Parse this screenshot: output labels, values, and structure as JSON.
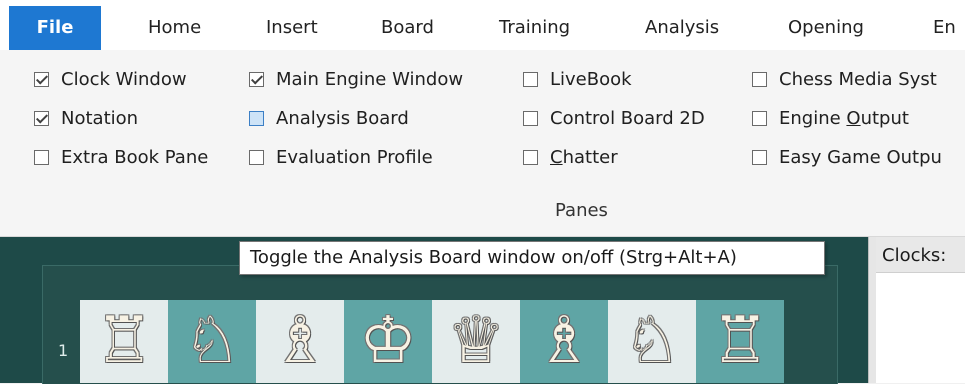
{
  "menu": {
    "tabs": [
      {
        "label": "File",
        "active": true
      },
      {
        "label": "Home"
      },
      {
        "label": "Insert"
      },
      {
        "label": "Board"
      },
      {
        "label": "Training"
      },
      {
        "label": "Analysis"
      },
      {
        "label": "Opening"
      },
      {
        "label": "En"
      }
    ]
  },
  "ribbon": {
    "group_label": "Panes",
    "col1": [
      {
        "label": "Clock Window",
        "checked": true
      },
      {
        "label": "Notation",
        "checked": true
      },
      {
        "label": "Extra Book Pane",
        "checked": false
      }
    ],
    "col2": [
      {
        "label": "Main Engine Window",
        "checked": true
      },
      {
        "label": "Analysis Board",
        "checked": false,
        "hover": true
      },
      {
        "label": "Evaluation Profile",
        "checked": false
      }
    ],
    "col3": [
      {
        "label": "LiveBook",
        "checked": false
      },
      {
        "label": "Control Board 2D",
        "checked": false
      },
      {
        "label_pre": "",
        "label_u": "C",
        "label_post": "hatter",
        "checked": false
      }
    ],
    "col4": [
      {
        "label": "Chess Media Syst",
        "checked": false
      },
      {
        "label_pre": "Engine ",
        "label_u": "O",
        "label_post": "utput",
        "checked": false
      },
      {
        "label": "Easy Game Outpu",
        "checked": false
      }
    ]
  },
  "tooltip": "Toggle the Analysis Board window on/off (Strg+Alt+A)",
  "clocks_header": "Clocks:",
  "board": {
    "rank_label": "1",
    "pieces": [
      "rook",
      "knight",
      "bishop",
      "king",
      "queen",
      "bishop",
      "knight",
      "rook"
    ],
    "glyphs": [
      "♖",
      "♘",
      "♗",
      "♔",
      "♕",
      "♗",
      "♘",
      "♖"
    ]
  },
  "colors": {
    "file_tab": "#1e78d2",
    "board_light": "#e4ecec",
    "board_dark": "#5fa5a5",
    "board_frame": "#1e4a48"
  }
}
